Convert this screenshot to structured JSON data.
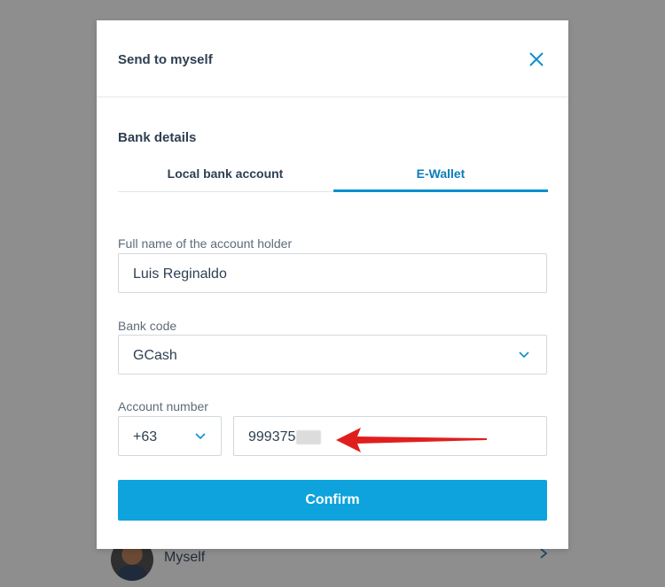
{
  "background": {
    "recipient_name": "Myself"
  },
  "modal": {
    "title": "Send to myself",
    "section_title": "Bank details",
    "tabs": [
      {
        "label": "Local bank account",
        "active": false
      },
      {
        "label": "E-Wallet",
        "active": true
      }
    ],
    "full_name": {
      "label": "Full name of the account holder",
      "value": "Luis Reginaldo"
    },
    "bank_code": {
      "label": "Bank code",
      "value": "GCash"
    },
    "account_number": {
      "label": "Account number",
      "country_code": "+63",
      "value": "999375"
    },
    "confirm_label": "Confirm"
  },
  "colors": {
    "accent": "#0ea3dc",
    "active_tab": "#0b7db8",
    "overlay": "#8e8e8e",
    "annotation_arrow": "#e01e1e"
  },
  "icons": {
    "close": "close-icon",
    "select": "chevron-down-icon",
    "background_row": "chevron-right-icon"
  }
}
